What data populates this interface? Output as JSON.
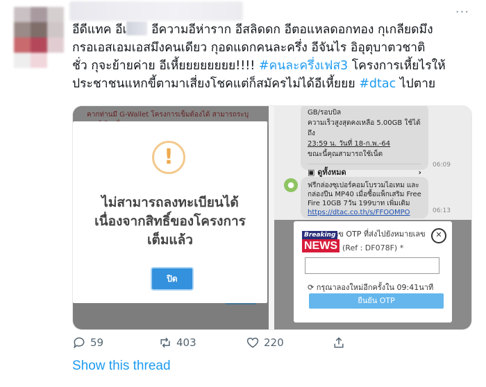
{
  "tweet": {
    "lines": [
      {
        "parts": [
          {
            "t": "อีดีแทค อีเ"
          },
          {
            "censor": true
          },
          {
            "t": " อีความอีห่าราก อีสลิดดก อีตอแหลดอกทอง กุเกลียดมึง"
          }
        ]
      },
      {
        "parts": [
          {
            "t": "กรอเอสเอมเอสมึงคนเดียว กุอดแดกคนละครึ่ง อีจันไร อิอุตุบาตวชาติ"
          }
        ]
      },
      {
        "parts": [
          {
            "t": "ชั่ว กุจะย้ายค่าย อีเหี้ยยยยยยยย!!!! "
          },
          {
            "t": "#คนละครึ่งเฟส3",
            "tag": true
          },
          {
            "t": " โครงการเหี้ยไรให้"
          }
        ]
      },
      {
        "parts": [
          {
            "t": "ประชาชนแหกขี้ตามาเสี่ยงโชคแต่ก็สมัครไม่ได้อีเหี้ยยย "
          },
          {
            "t": "#dtac",
            "tag": true
          },
          {
            "t": " ไปตาย"
          }
        ]
      }
    ]
  },
  "media_left": {
    "bg_text": "คากท่านมี G-Wallet โครงการเข็มต้องได้ สามารถระบุเบอร์เติมเพื่อ",
    "dialog_message_1": "ไม่สามารถลงทะเบียนได้",
    "dialog_message_2": "เนื่องจากสิทธิ์ของโครงการ",
    "dialog_message_3": "เต็มแล้ว",
    "close_label": "ปิด",
    "warn_glyph": "!"
  },
  "media_right": {
    "sms1_line1": "GB/รอบบิล",
    "sms1_line2": "ความเร็วสูงสุดคงเหลือ 5.00GB ใช้ได้ถึง",
    "sms1_line3": "23:59 น. วันที่ 18-ก.พ.-64",
    "sms1_line4": "ขณะนี้คุณสามารถใช้เน็ต",
    "sms1_link": "ดูทั้งหมด",
    "sms1_time": "06:09",
    "sms2_line1": "ฟรีกล่องซุเปอร์คอมโบรวมไอเทม และ",
    "sms2_line2": "กล่องปืน MP40 เมื่อซื้อแพ็กเสริม Free",
    "sms2_line3": "Fire 10GB 7วัน 199บาท เพิ่มเติม",
    "sms2_link": "https://dtac.co.th/s/FFOOMPO",
    "sms2_time": "06:13",
    "otp_title": "กรอกเลข OTP ที่ส่งไปยังหมายเลข",
    "otp_ref": "(Ref : DF078F)  *",
    "news_breaking": "Breaking",
    "news_label": "NEWS",
    "otp_resend": "กรุณาลองใหม่อีกครั้งใน 09:41นาที",
    "otp_confirm": "ยืนยัน OTP"
  },
  "actions": {
    "reply_count": "59",
    "retweet_count": "403",
    "like_count": "220"
  },
  "show_thread": "Show this thread",
  "colors": {
    "link": "#1d9bf0",
    "text": "#0f1419",
    "muted": "#536471"
  }
}
